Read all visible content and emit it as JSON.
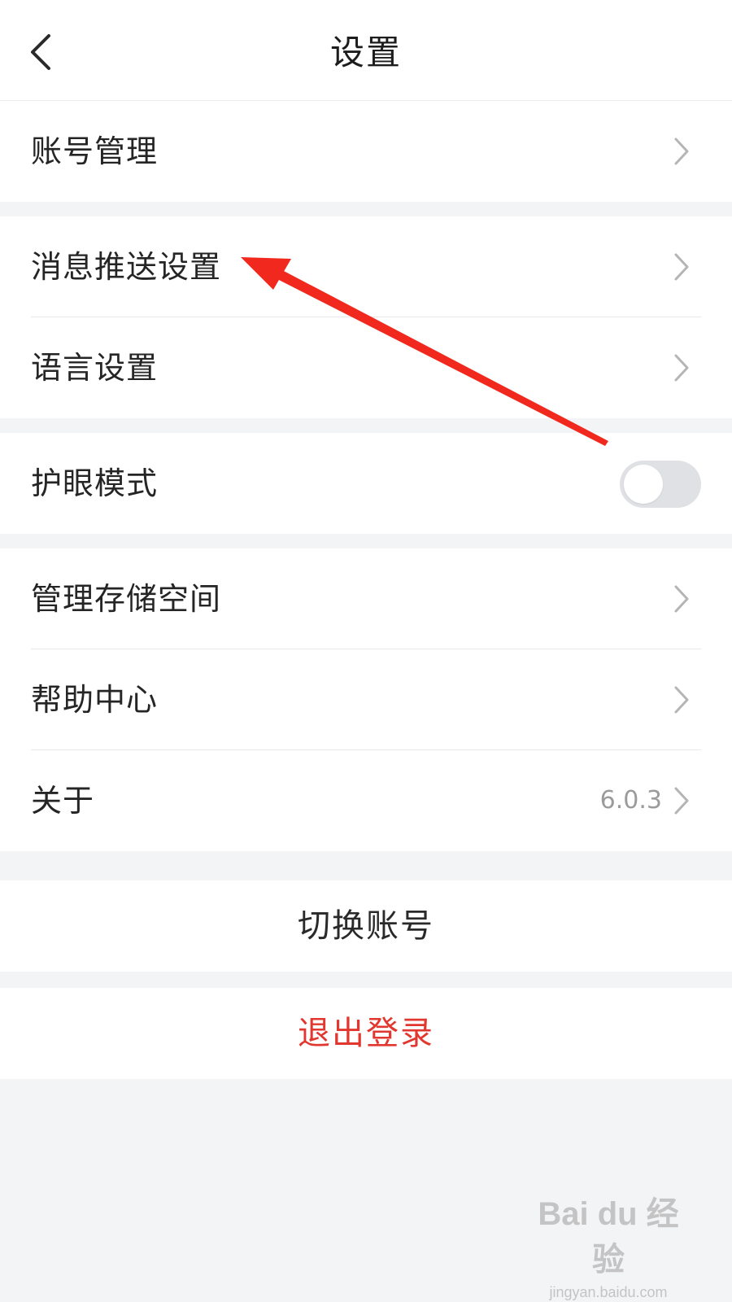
{
  "header": {
    "title": "设置",
    "back_icon": "chevron-left-icon"
  },
  "groups": [
    {
      "items": [
        {
          "label": "账号管理",
          "icon": "chevron-right-icon"
        }
      ]
    },
    {
      "items": [
        {
          "label": "消息推送设置",
          "icon": "chevron-right-icon"
        },
        {
          "label": "语言设置",
          "icon": "chevron-right-icon"
        }
      ]
    },
    {
      "items": [
        {
          "label": "护眼模式",
          "toggle_on": false
        }
      ]
    },
    {
      "items": [
        {
          "label": "管理存储空间",
          "icon": "chevron-right-icon"
        },
        {
          "label": "帮助中心",
          "icon": "chevron-right-icon"
        },
        {
          "label": "关于",
          "value": "6.0.3",
          "icon": "chevron-right-icon"
        }
      ]
    }
  ],
  "actions": {
    "switch_account": "切换账号",
    "logout": "退出登录"
  },
  "colors": {
    "background": "#f3f4f6",
    "card": "#ffffff",
    "logout_text": "#e2372f",
    "annotation_arrow": "#f0281e",
    "toggle_off": "#dfe1e4",
    "chevron": "#b5b5b5"
  },
  "watermark": {
    "main": "Bai du 经验",
    "sub": "jingyan.baidu.com"
  }
}
